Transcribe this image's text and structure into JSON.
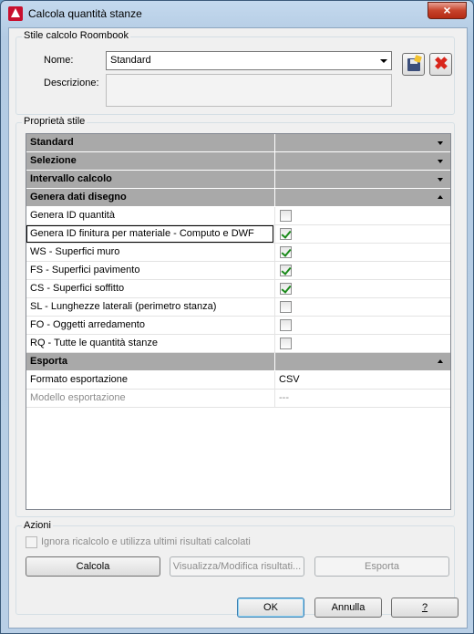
{
  "window": {
    "title": "Calcola quantità stanze",
    "close_glyph": "×"
  },
  "style_group": {
    "label": "Stile calcolo Roombook",
    "name_label": "Nome:",
    "name_value": "Standard",
    "description_label": "Descrizione:",
    "description_value": "",
    "save_icon": "save-style-icon",
    "delete_icon": "delete-style-icon",
    "delete_glyph": "✖"
  },
  "properties": {
    "label": "Proprietà stile",
    "rows": [
      {
        "type": "category",
        "name": "Standard",
        "expanded": false
      },
      {
        "type": "category",
        "name": "Selezione",
        "expanded": false
      },
      {
        "type": "category",
        "name": "Intervallo calcolo",
        "expanded": false
      },
      {
        "type": "category",
        "name": "Genera dati disegno",
        "expanded": true
      },
      {
        "type": "checkbox",
        "name": "Genera ID quantità",
        "checked": false
      },
      {
        "type": "checkbox",
        "name": "Genera ID finitura per materiale - Computo e DWF",
        "checked": true,
        "selected": true
      },
      {
        "type": "checkbox",
        "name": "WS - Superfici muro",
        "checked": true
      },
      {
        "type": "checkbox",
        "name": "FS - Superfici pavimento",
        "checked": true
      },
      {
        "type": "checkbox",
        "name": "CS - Superfici soffitto",
        "checked": true
      },
      {
        "type": "checkbox",
        "name": "SL - Lunghezze laterali (perimetro stanza)",
        "checked": false
      },
      {
        "type": "checkbox",
        "name": "FO - Oggetti arredamento",
        "checked": false
      },
      {
        "type": "checkbox",
        "name": "RQ - Tutte le quantità stanze",
        "checked": false
      },
      {
        "type": "category",
        "name": "Esporta",
        "expanded": true
      },
      {
        "type": "text",
        "name": "Formato esportazione",
        "value": "CSV"
      },
      {
        "type": "text",
        "name": "Modello esportazione",
        "value": "---",
        "disabled": true
      }
    ]
  },
  "actions": {
    "label": "Azioni",
    "ignore_label": "Ignora ricalcolo e utilizza ultimi risultati calcolati",
    "calc_label": "Calcola",
    "view_label": "Visualizza/Modifica risultati...",
    "export_label": "Esporta"
  },
  "footer": {
    "ok_label": "OK",
    "cancel_label": "Annulla",
    "help_label": "?"
  }
}
